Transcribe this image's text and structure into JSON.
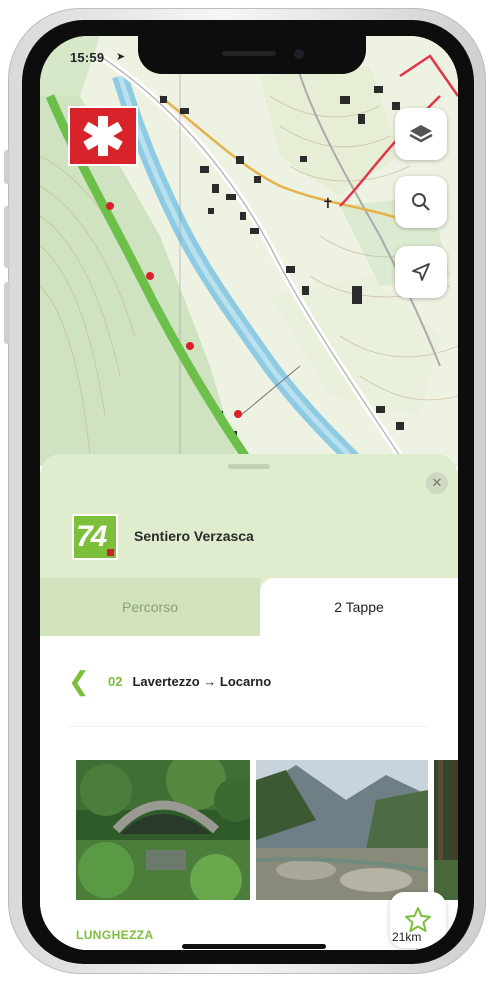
{
  "status_bar": {
    "time": "15:59",
    "location_arrow": "➤"
  },
  "app": {
    "logo_glyph": "✱",
    "brand_color": "#d8232a"
  },
  "map": {
    "controls": [
      {
        "name": "layers-icon"
      },
      {
        "name": "search-icon"
      },
      {
        "name": "locate-icon"
      }
    ],
    "route_color": "#6cc04a",
    "river_color": "#8ecbe3"
  },
  "route": {
    "number": "74",
    "title": "Sentiero Verzasca",
    "badge_color": "#7bbf3a"
  },
  "tabs": [
    {
      "label": "Percorso",
      "active": false
    },
    {
      "label": "2 Tappe",
      "active": true
    }
  ],
  "stage": {
    "back_glyph": "❮",
    "number": "02",
    "name": "Lavertezzo → Locarno"
  },
  "favorite": {
    "glyph": "☆"
  },
  "length": {
    "label": "LUNGHEZZA",
    "value": "21km"
  },
  "accent_color": "#7bbf3a"
}
